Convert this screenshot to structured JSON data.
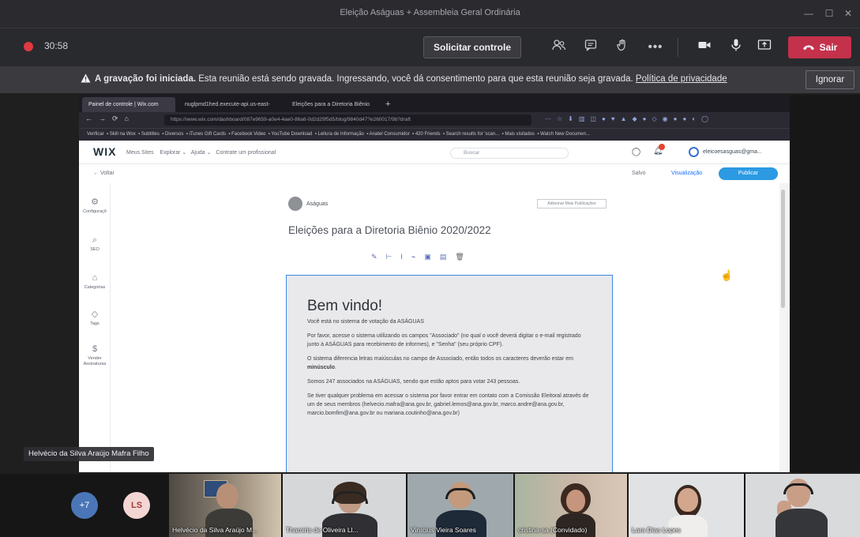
{
  "window": {
    "title": "Eleição Aságuas + Assembleia Geral Ordinária",
    "minimize_glyph": "—",
    "maximize_glyph": "☐",
    "close_glyph": "✕"
  },
  "toolbar": {
    "timer": "30:58",
    "request_control_label": "Solicitar controle",
    "leave_label": "Sair",
    "icons": [
      "participants-icon",
      "chat-icon",
      "raise-hand-icon",
      "more-actions-icon",
      "camera-icon",
      "microphone-icon",
      "share-screen-icon",
      "phone-hangup-icon"
    ],
    "colors": {
      "leave": "#c4314b",
      "recording": "#e0393f"
    }
  },
  "banner": {
    "headline": "A gravação foi iniciada.",
    "text": "Esta reunião está sendo gravada. Ingressando, você dá consentimento para que esta reunião seja gravada.",
    "link": "Política de privacidade",
    "ignore_label": "Ignorar"
  },
  "shared_screen": {
    "browser": {
      "tabs": [
        "Painel de controle | Wix.com",
        "nuglpmd1hed.execute-api.us-east-",
        "Eleições para a Diretoria Biênio"
      ],
      "new_tab_glyph": "+",
      "url": "https://www.wix.com/dashboard/087e9659-a0e4-4ae0-86a6-0d2d29f5d5/blog/9840d47?e260017/9b?draft",
      "bookmarks": [
        "Verificar",
        "Skill na Wox",
        "Subtitles",
        "Diversos",
        "iTunes Gift Cards",
        "Facebook Video",
        "YouTube Download",
        "Leitura de Informação",
        "Anatel Consumidor",
        "420 Friends",
        "Search results for 'scan...",
        "Mais visitados",
        "Watch New Documen..."
      ]
    },
    "wix": {
      "logo": "WIX",
      "nav": [
        "Meus Sites",
        "Explorar",
        "Ajuda",
        "Contrate um profissional"
      ],
      "search_placeholder": "Buscar",
      "user": "eleicoesasguas@gma...",
      "back": "← Voltar",
      "saved": "Salvo",
      "preview": "Visualização",
      "publish": "Publicar",
      "sidebar": [
        {
          "label": "Configuraçõ",
          "icon": "settings-icon"
        },
        {
          "label": "SEO",
          "icon": "search-icon"
        },
        {
          "label": "Categorias",
          "icon": "categories-icon"
        },
        {
          "label": "Tags",
          "icon": "tag-icon"
        },
        {
          "label": "Vender Assinaturas",
          "icon": "dollar-icon"
        }
      ]
    },
    "post": {
      "author": "Aságuas",
      "action_button": "Adicionar Mais Publicações",
      "title": "Eleições para a Diretoria Biênio 2020/2022",
      "welcome": "Bem vindo!",
      "paragraphs": [
        "Você está no sistema de votação da ASÁGUAS",
        "Por favor, acesse o sistema utilizando os campos \"Associado\" (no qual o você deverá digitar o e-mail registrado junto à ASÁGUAS para recebimento de informes), e \"Senha\" (seu próprio CPF).",
        "Somos 247 associados na ASÁGUAS, sendo que estão aptos para votar 243 pessoas.",
        "Se tiver qualquer problema em acessar o sistema por favor entrar em contato com a Comissão Eleitoral através de um de seus membros (helvecio.mafra@ana.gov.br, gabriel.lemos@ana.gov.br, marco.andre@ana.gov.br, marcio.bomfim@ana.gov.br ou mariana.coutinho@ana.gov.br)"
      ],
      "case_note_prefix": "O sistema diferencia letras maiúsculas no campo de Associado, então todos os caracteres deverão estar em",
      "case_note_bold": "minúsculo",
      "case_note_suffix": "."
    }
  },
  "presenter_label": "Helvécio da Silva Araújo Mafra Filho",
  "participants": {
    "overflow_count": "+7",
    "initials": "LS",
    "tiles": [
      "Helvécio da Silva Araújo M...",
      "Thamiris de Oliveira Ll...",
      "Vinícius Vieira Soares",
      "cristina-sa (Convidado)",
      "Lara Dias Lopes",
      ""
    ]
  }
}
